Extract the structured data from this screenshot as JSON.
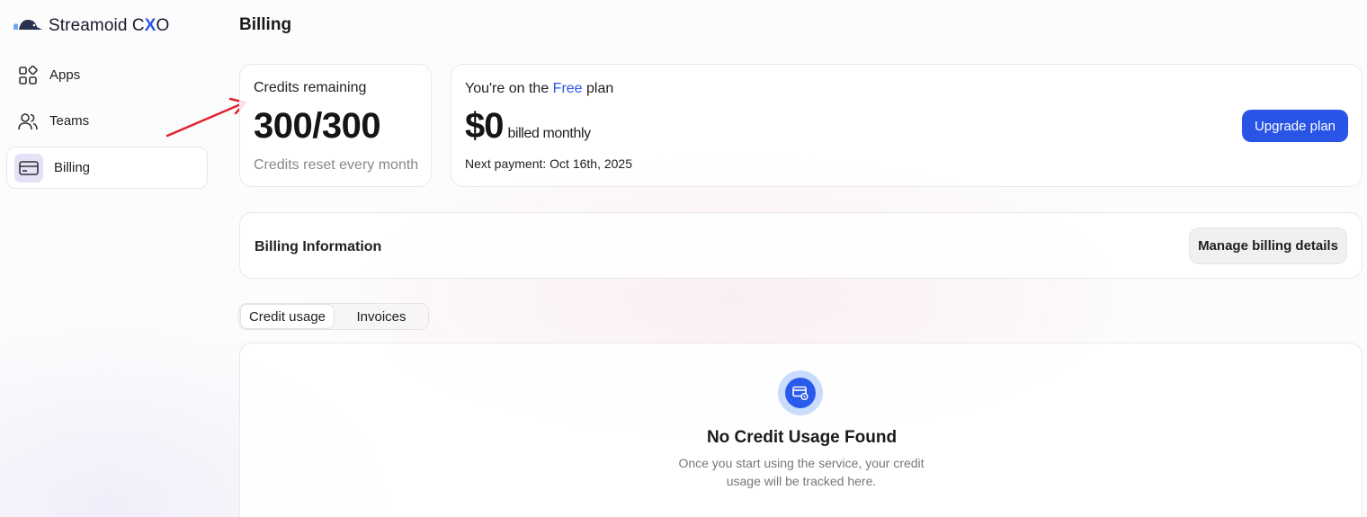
{
  "brand": {
    "name_prefix": "Streamoid C",
    "name_x": "X",
    "name_suffix": "O"
  },
  "sidebar": {
    "items": [
      {
        "label": "Apps",
        "icon": "apps-grid-icon"
      },
      {
        "label": "Teams",
        "icon": "users-icon"
      },
      {
        "label": "Billing",
        "icon": "credit-card-icon",
        "active": true
      }
    ]
  },
  "page": {
    "title": "Billing"
  },
  "credits": {
    "label": "Credits remaining",
    "value": "300/300",
    "note": "Credits reset every month"
  },
  "plan": {
    "prefix": "You're on the",
    "plan_name": "Free",
    "suffix": "plan",
    "price": "$0",
    "period": "billed monthly",
    "next_payment": "Next payment: Oct 16th, 2025",
    "upgrade_label": "Upgrade plan"
  },
  "billing_info": {
    "title": "Billing Information",
    "manage_label": "Manage billing details"
  },
  "tabs": [
    {
      "label": "Credit usage",
      "active": true
    },
    {
      "label": "Invoices",
      "active": false
    }
  ],
  "empty_state": {
    "title": "No Credit Usage Found",
    "description": "Once you start using the service, your credit usage will be tracked here."
  },
  "colors": {
    "accent": "#2954e6",
    "annotation_arrow": "#e0222f"
  }
}
